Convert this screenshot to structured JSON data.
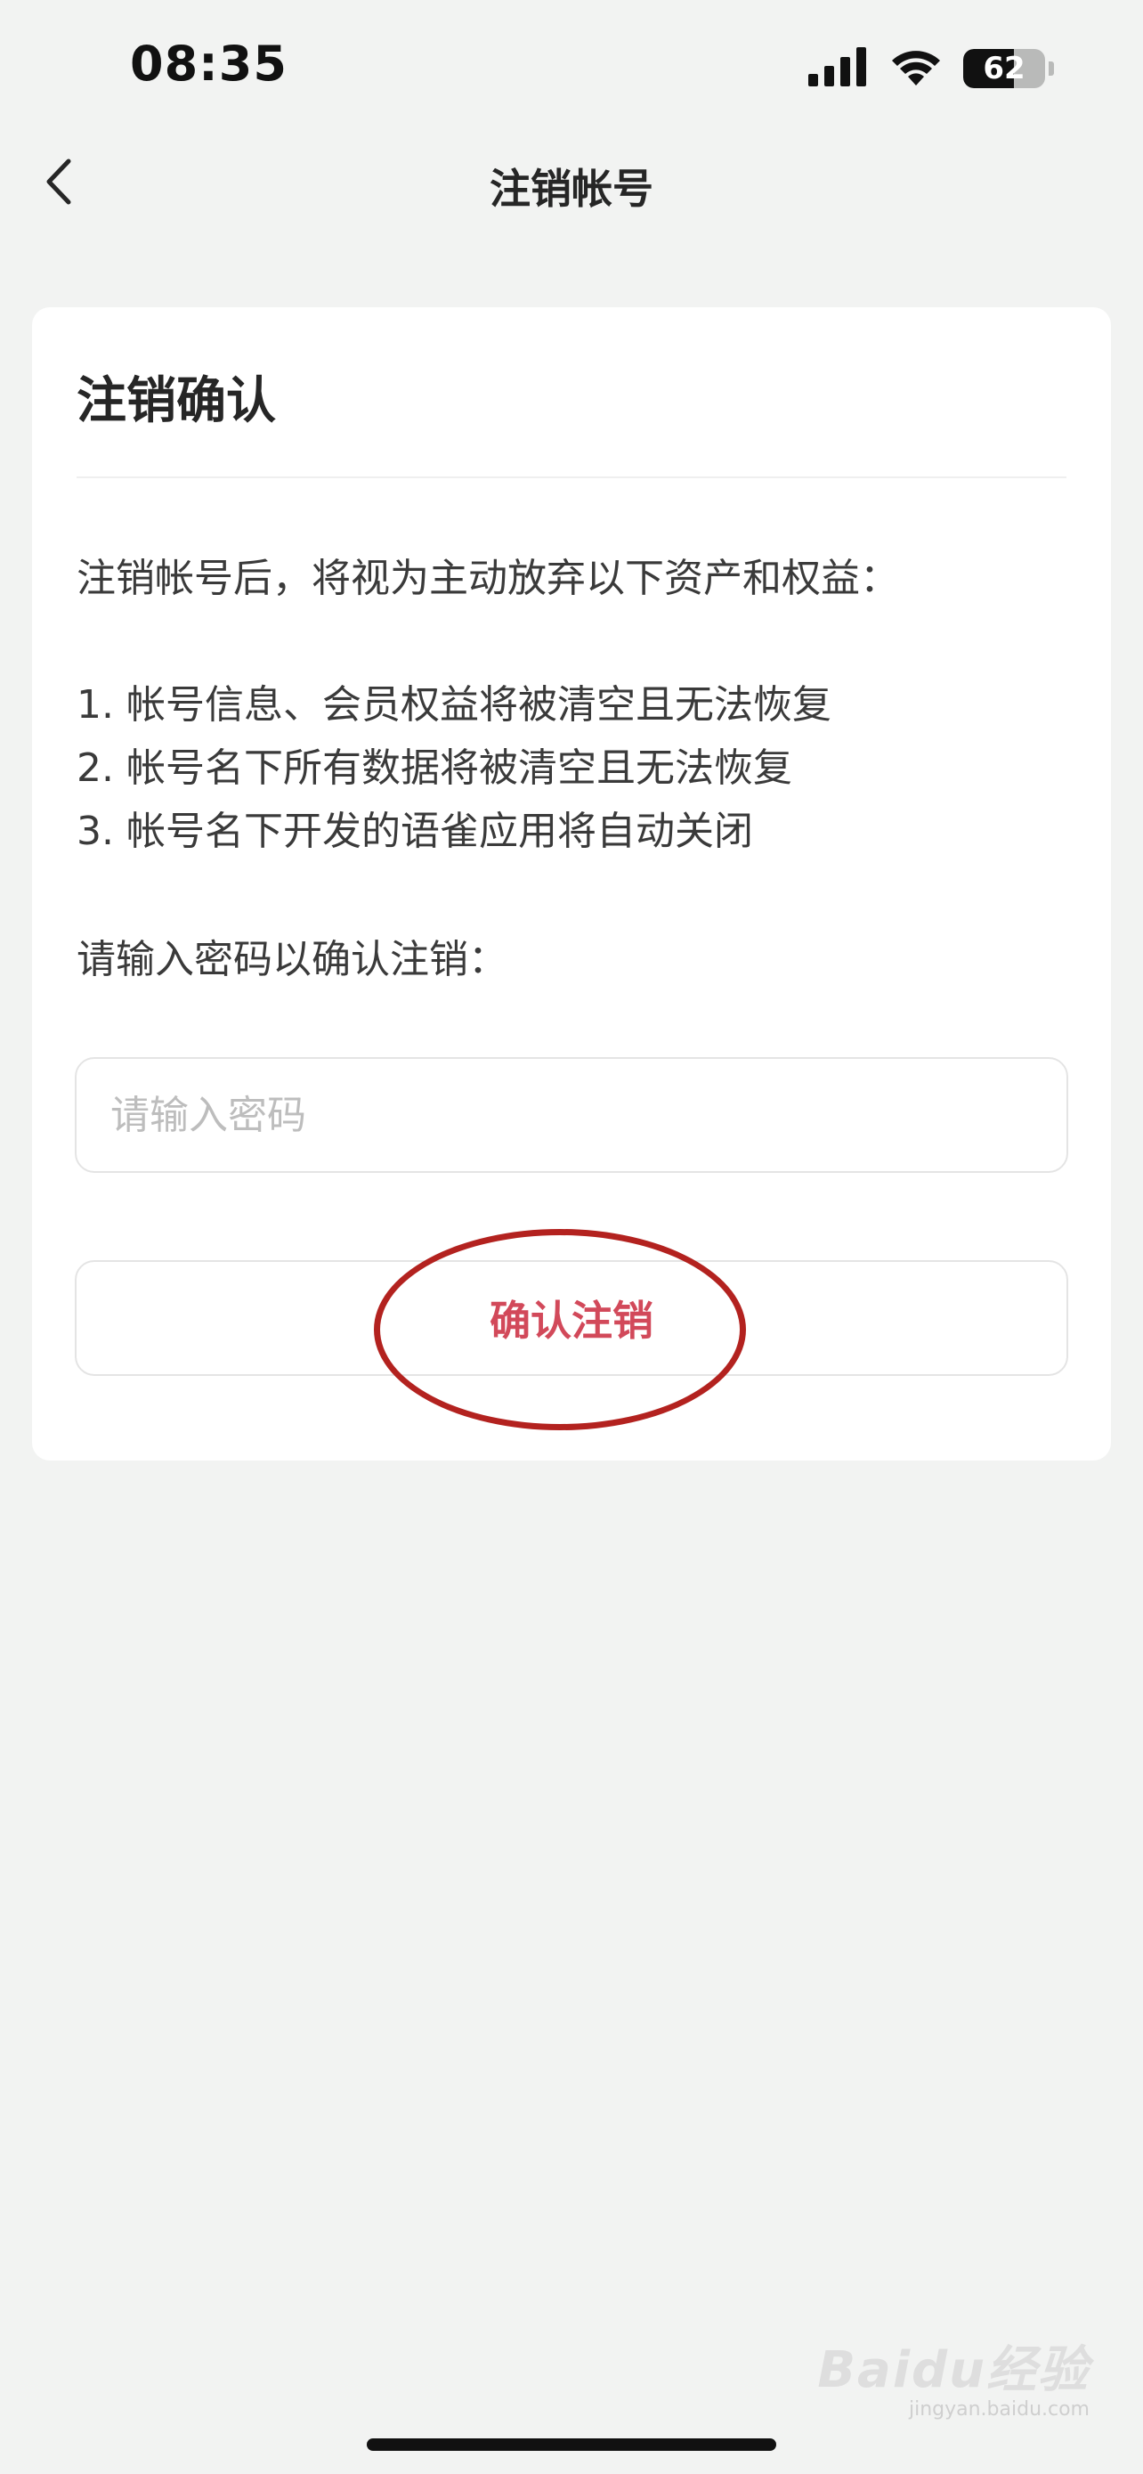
{
  "status_bar": {
    "time": "08:35",
    "battery_level": "62",
    "battery_fraction": 0.62
  },
  "nav": {
    "title": "注销帐号",
    "back_icon": "chevron-left-icon"
  },
  "card": {
    "title": "注销确认",
    "intro": "注销帐号后，将视为主动放弃以下资产和权益：",
    "items": [
      "1. 帐号信息、会员权益将被清空且无法恢复",
      "2. 帐号名下所有数据将被清空且无法恢复",
      "3. 帐号名下开发的语雀应用将自动关闭"
    ],
    "password_prompt": "请输入密码以确认注销：",
    "password_placeholder": "请输入密码",
    "password_value": "",
    "confirm_label": "确认注销"
  },
  "colors": {
    "background": "#f2f3f2",
    "danger_text": "#d2495a",
    "annotation": "#b3221f"
  },
  "watermark": {
    "logo": "Baidu经验",
    "url": "jingyan.baidu.com"
  }
}
